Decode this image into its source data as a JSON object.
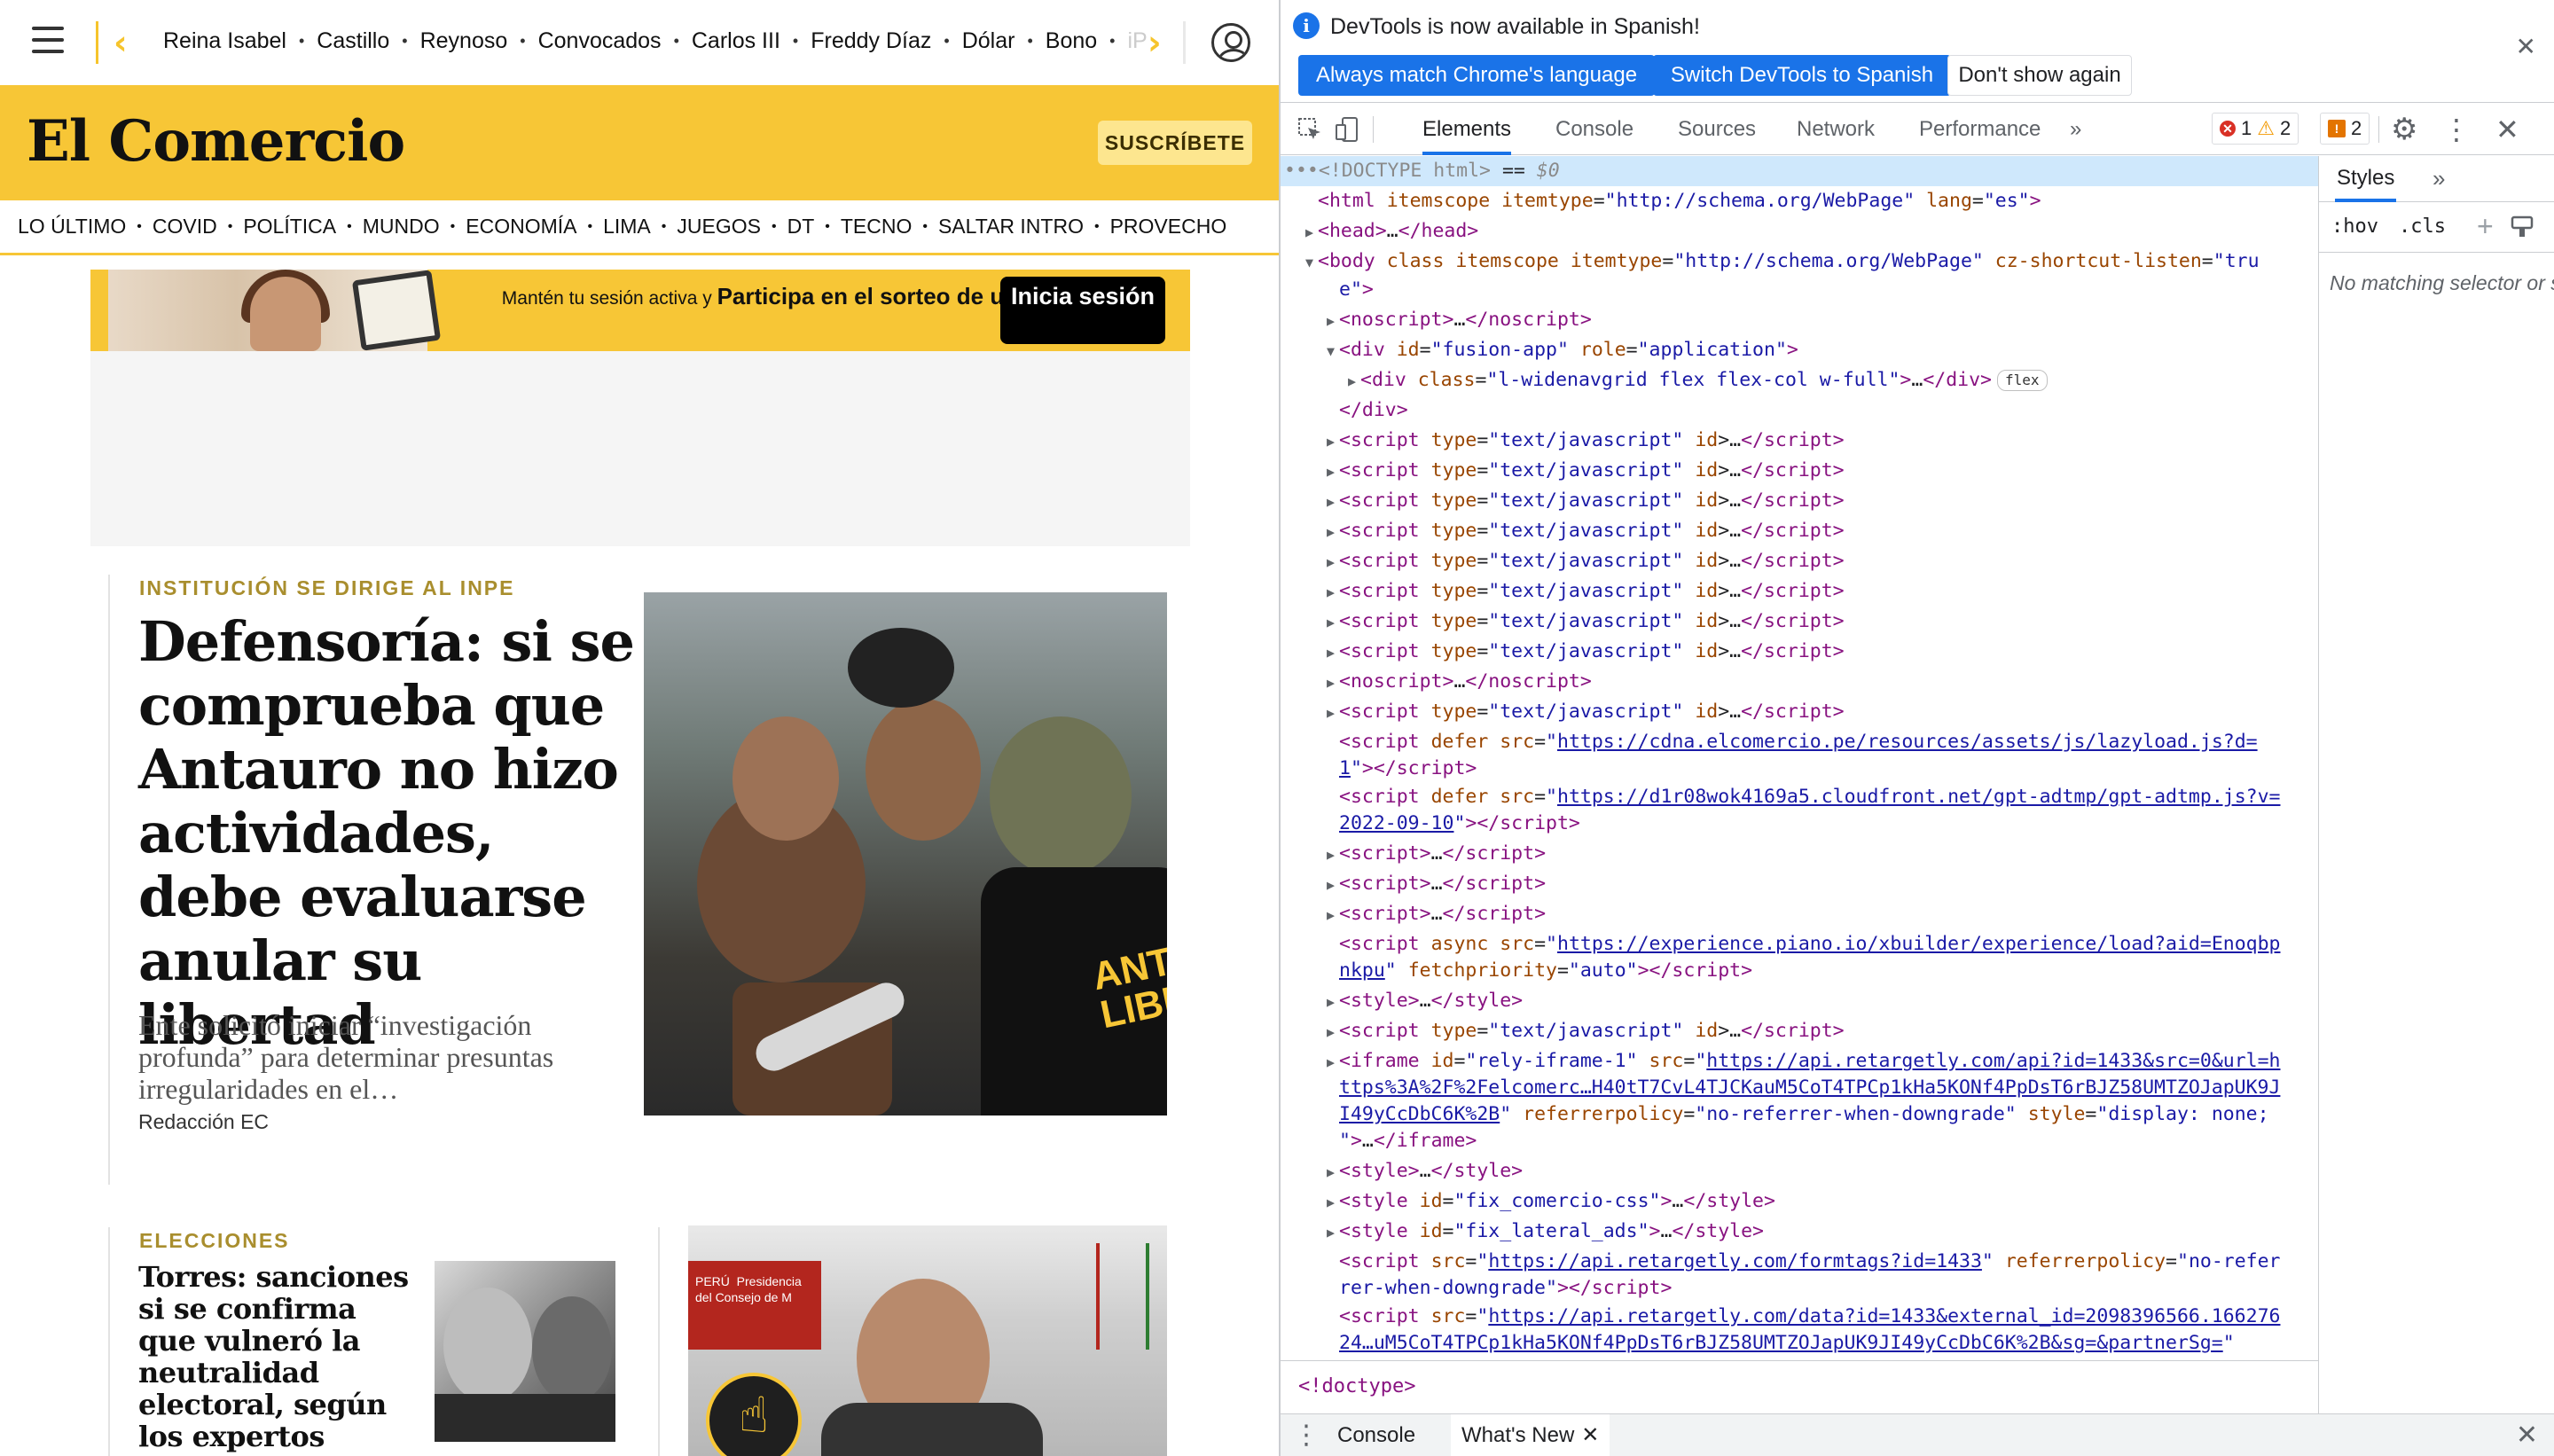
{
  "site": {
    "hot_topics": [
      "Reina Isabel",
      "Castillo",
      "Reynoso",
      "Convocados",
      "Carlos III",
      "Freddy Díaz",
      "Dólar",
      "Bono"
    ],
    "hot_topics_faded": "iP",
    "logo": "El Comercio",
    "subscribe_label": "SUSCRÍBETE",
    "sections": [
      "LO ÚLTIMO",
      "COVID",
      "POLÍTICA",
      "MUNDO",
      "ECONOMÍA",
      "LIMA",
      "JUEGOS",
      "DT",
      "TECNO",
      "SALTAR INTRO",
      "PROVECHO"
    ],
    "promo": {
      "text_small": "Mantén tu sesión activa y ",
      "text_bold": "Participa en el sorteo de un iPad",
      "button": "Inicia sesión"
    },
    "story1": {
      "kicker": "INSTITUCIÓN SE DIRIGE AL INPE",
      "headline": "Defensoría: si se comprueba que Antauro no hizo actividades, debe evaluarse anular su libertad",
      "summary": "Ente solicitó iniciar “investigación profunda” para determinar presuntas irregularidades en el…",
      "byline": "Redacción EC"
    },
    "story2": {
      "kicker": "ELECCIONES",
      "headline": "Torres: sanciones si se confirma que vulneró la neutralidad electoral, según los expertos"
    },
    "photo1_caption_text": "ANTA\nLIBE",
    "photo2_sign": "PERÚ  Presidencia del Consejo de M"
  },
  "devtools": {
    "infobar": {
      "message": "DevTools is now available in Spanish!",
      "btn_match": "Always match Chrome's language",
      "btn_switch": "Switch DevTools to Spanish",
      "btn_dismiss": "Don't show again"
    },
    "tabs": [
      "Elements",
      "Console",
      "Sources",
      "Network",
      "Performance"
    ],
    "more_tabs": "»",
    "counters": {
      "errors": "1",
      "warnings": "2",
      "issues": "2"
    },
    "breadcrumb": "<!doctype>",
    "styles": {
      "tab": "Styles",
      "more": "»",
      "hov": ":hov",
      "cls": ".cls",
      "no_match": "No matching selector or style"
    },
    "drawer": {
      "console": "Console",
      "whats_new": "What's New"
    }
  }
}
